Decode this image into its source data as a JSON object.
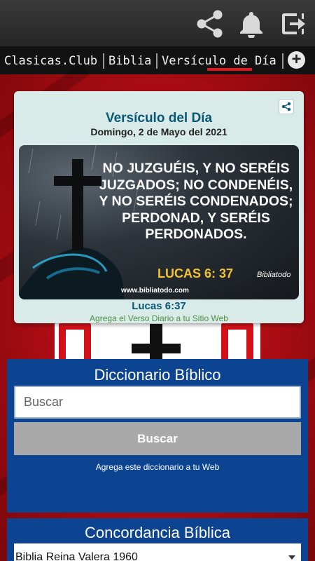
{
  "tabs": [
    {
      "label": "Clasicas.Club"
    },
    {
      "label": "Biblia"
    },
    {
      "label": "Versículo de Día"
    }
  ],
  "tab_add_label": "+",
  "verse_card": {
    "title": "Versículo del Día",
    "date": "Domingo, 2 de Mayo del 2021",
    "image_text": "NO JUZGUÉIS, Y NO SERÉIS JUZGADOS; NO CONDENÉIS, Y NO SERÉIS CONDENADOS; PERDONAD, Y SERÉIS PERDONADOS.",
    "image_reference": "LUCAS 6: 37",
    "image_url": "www.bibliatodo.com",
    "image_brand": "Bibliatodo",
    "reference": "Lucas 6:37",
    "add_link": "Agrega el Verso Diario a tu Sitio Web"
  },
  "dictionary": {
    "title": "Diccionario Bíblico",
    "search_placeholder": "Buscar",
    "search_button": "Buscar",
    "add_link": "Agrega este diccionario a tu Web"
  },
  "concordance": {
    "title": "Concordancia Bíblica",
    "selected_version": "Biblia Reina Valera 1960"
  },
  "colors": {
    "accent_red": "#e3161d",
    "panel_blue": "#0d4491",
    "verse_title": "#0a5877",
    "link_green": "#4f8f45"
  },
  "icons": {
    "share": "share-icon",
    "bell": "bell-icon",
    "exit": "exit-icon"
  }
}
